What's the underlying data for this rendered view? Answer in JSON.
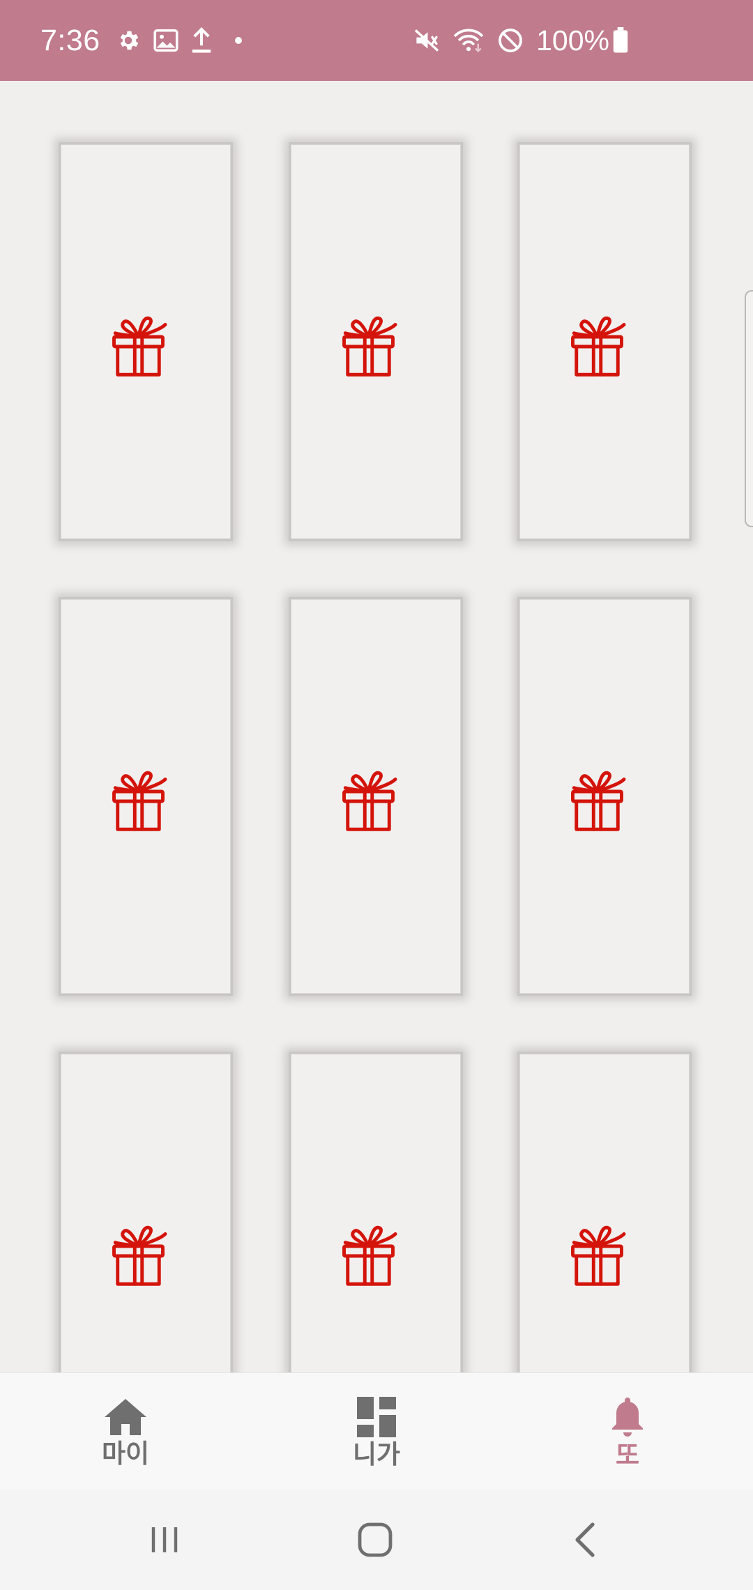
{
  "status_bar": {
    "time": "7:36",
    "battery": "100%",
    "left_icons": [
      "settings-gear-icon",
      "image-notification-icon",
      "upload-icon",
      "dot-icon"
    ],
    "right_icons": [
      "vibrate-mute-icon",
      "wifi-icon",
      "do-not-disturb-icon",
      "battery-icon"
    ],
    "background": "#c07b8d"
  },
  "grid": {
    "card_icon": "gift-icon",
    "icon_color": "#d4140a",
    "card_count": 9
  },
  "bottom_nav": {
    "items": [
      {
        "label": "마이",
        "icon": "home-icon",
        "active": false
      },
      {
        "label": "니가",
        "icon": "dashboard-icon",
        "active": false
      },
      {
        "label": "또",
        "icon": "bell-icon",
        "active": true
      }
    ],
    "active_color": "#c07b8d",
    "inactive_color": "#6f6f6f"
  },
  "system_nav": {
    "buttons": [
      "recent-apps-icon",
      "home-circle-icon",
      "back-icon"
    ]
  }
}
